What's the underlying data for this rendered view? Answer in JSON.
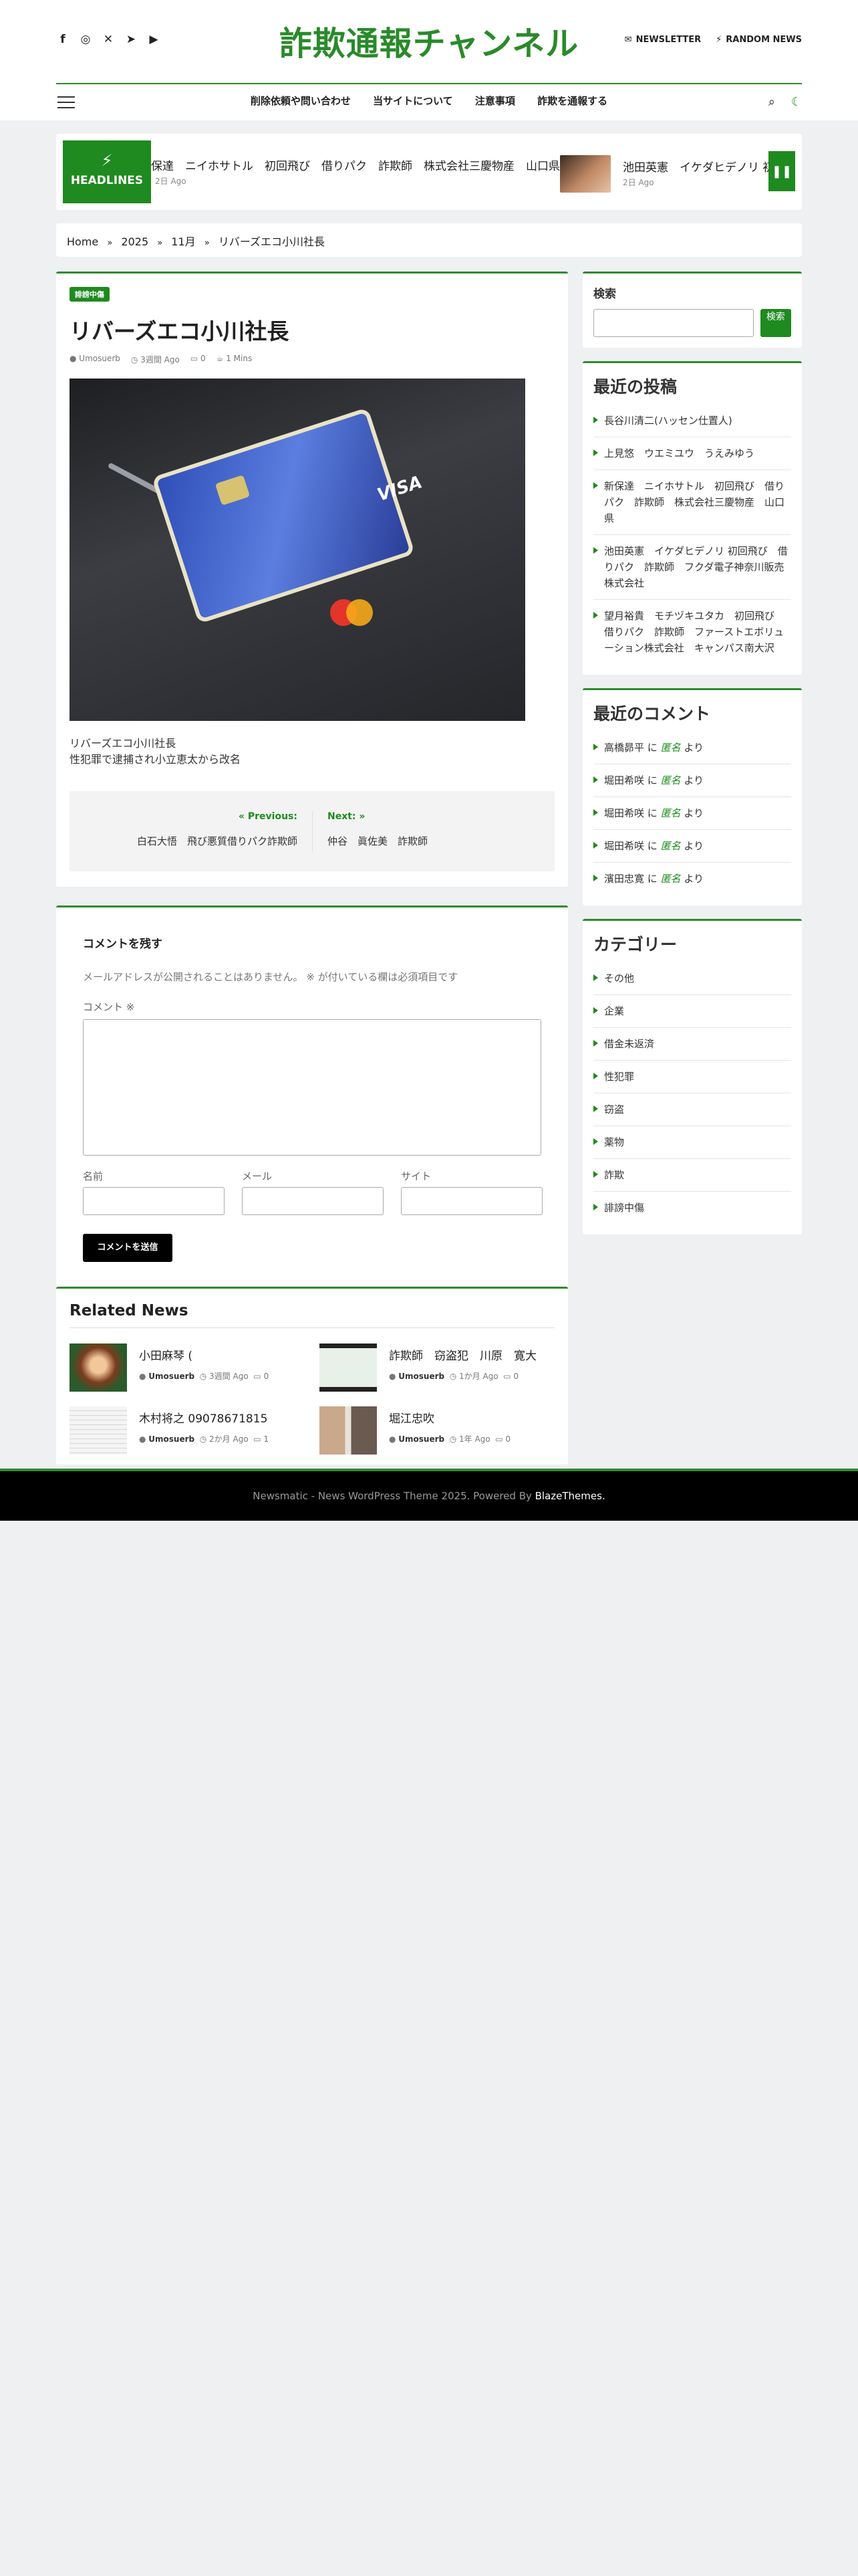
{
  "header": {
    "site_title": "詐欺通報チャンネル",
    "social_icons": [
      "facebook-icon",
      "instagram-icon",
      "x-icon",
      "telegram-icon",
      "youtube-icon"
    ],
    "newsletter": "NEWSLETTER",
    "random_news": "RANDOM NEWS"
  },
  "nav": {
    "items": [
      "削除依頼や問い合わせ",
      "当サイトについて",
      "注意事項",
      "詐欺を通報する"
    ]
  },
  "ticker": {
    "label": "HEADLINES",
    "text": "保達　ニイホサトル　初回飛び　借りパク　詐欺師　株式会社三慶物産　山口県",
    "date": "2日 Ago",
    "title2": "池田英憲　イケダヒデノリ 初回",
    "date2": "2日 Ago"
  },
  "breadcrumb": {
    "home": "Home",
    "year": "2025",
    "month": "11月",
    "current": "リバーズエコ小川社長"
  },
  "article": {
    "category": "誹謗中傷",
    "title": "リバーズエコ小川社長",
    "author": "Umosuerb",
    "time": "3週間 Ago",
    "comments": "0",
    "read": "1 Mins",
    "line1": "リバーズエコ小川社長",
    "line2": "性犯罪で逮捕され小立恵太から改名",
    "prev_label": "Previous:",
    "prev_title": "白石大悟　飛び悪質借りパク詐欺師",
    "next_label": "Next:",
    "next_title": "仲谷　眞佐美　詐欺師"
  },
  "comment_form": {
    "title": "コメントを残す",
    "note": "メールアドレスが公開されることはありません。 ※ が付いている欄は必須項目です",
    "comment_label": "コメント ※",
    "name_label": "名前",
    "email_label": "メール",
    "site_label": "サイト",
    "submit": "コメントを送信"
  },
  "related": {
    "heading": "Related News",
    "items": [
      {
        "title": "小田麻琴 (",
        "author": "Umosuerb",
        "time": "3週間 Ago",
        "comments": "0"
      },
      {
        "title": "詐欺師　窃盗犯　川原　寛大",
        "author": "Umosuerb",
        "time": "1か月 Ago",
        "comments": "0"
      },
      {
        "title": "木村将之 09078671815",
        "author": "Umosuerb",
        "time": "2か月 Ago",
        "comments": "1"
      },
      {
        "title": "堀江忠吹",
        "author": "Umosuerb",
        "time": "1年 Ago",
        "comments": "0"
      }
    ]
  },
  "sidebar": {
    "search_title": "検索",
    "search_button": "検索",
    "recent_posts_title": "最近の投稿",
    "recent_posts": [
      "長谷川清二(ハッセン仕置人)",
      "上見悠　ウエミユウ　うえみゆう",
      "新保達　ニイホサトル　初回飛び　借りパク　詐欺師　株式会社三慶物産　山口県",
      "池田英憲　イケダヒデノリ 初回飛び　借りパク　詐欺師　フクダ電子神奈川販売株式会社",
      "望月裕貴　モチヅキユタカ　初回飛び　借りパク　詐欺師　ファーストエボリューション株式会社　キャンパス南大沢"
    ],
    "recent_comments_title": "最近のコメント",
    "recent_comments": [
      {
        "post": "高橋昴平",
        "by": "匿名"
      },
      {
        "post": "堀田希咲",
        "by": "匿名"
      },
      {
        "post": "堀田希咲",
        "by": "匿名"
      },
      {
        "post": "堀田希咲",
        "by": "匿名"
      },
      {
        "post": "濱田忠寛",
        "by": "匿名"
      }
    ],
    "comment_join_1": " に ",
    "comment_join_2": " より",
    "categories_title": "カテゴリー",
    "categories": [
      "その他",
      "企業",
      "借金未返済",
      "性犯罪",
      "窃盗",
      "薬物",
      "詐欺",
      "誹謗中傷"
    ]
  },
  "footer": {
    "text": "Newsmatic - News WordPress Theme 2025. Powered By ",
    "link": "BlazeThemes."
  },
  "colors": {
    "accent": "#1f8a1f",
    "footer_bg": "#000000",
    "page_bg": "#eef0f2"
  }
}
